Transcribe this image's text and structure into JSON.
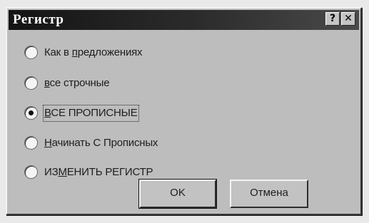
{
  "dialog": {
    "title": "Регистр",
    "help_glyph": "?",
    "close_glyph": "✕"
  },
  "options": [
    {
      "label_pre": "Как в ",
      "label_ul": "п",
      "label_post": "редложениях",
      "selected": false
    },
    {
      "label_pre": "",
      "label_ul": "в",
      "label_post": "се строчные",
      "selected": false
    },
    {
      "label_pre": "",
      "label_ul": "В",
      "label_post": "СЕ ПРОПИСНЫЕ",
      "selected": true
    },
    {
      "label_pre": "",
      "label_ul": "Н",
      "label_post": "ачинать С Прописных",
      "selected": false
    },
    {
      "label_pre": "ИЗ",
      "label_ul": "М",
      "label_post": "ЕНИТЬ РЕГИСТР",
      "selected": false
    }
  ],
  "buttons": {
    "ok_label": "OK",
    "cancel_label": "Отмена"
  }
}
